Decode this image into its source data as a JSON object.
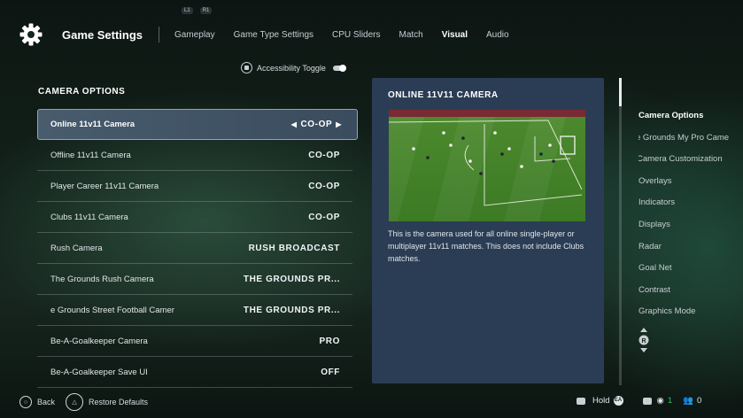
{
  "top_chips": [
    "L1",
    "R1"
  ],
  "header": {
    "title": "Game Settings",
    "tabs": [
      "Gameplay",
      "Game Type Settings",
      "CPU Sliders",
      "Match",
      "Visual",
      "Audio"
    ],
    "active_tab": "Visual"
  },
  "accessibility": {
    "label": "Accessibility Toggle",
    "on": true
  },
  "section_title": "CAMERA OPTIONS",
  "rows": [
    {
      "label": "Online 11v11 Camera",
      "value": "CO-OP",
      "selected": true
    },
    {
      "label": "Offline 11v11 Camera",
      "value": "CO-OP"
    },
    {
      "label": "Player Career 11v11 Camera",
      "value": "CO-OP"
    },
    {
      "label": "Clubs 11v11 Camera",
      "value": "CO-OP"
    },
    {
      "label": "Rush Camera",
      "value": "RUSH BROADCAST"
    },
    {
      "label": "The Grounds Rush Camera",
      "value": "THE GROUNDS PR..."
    },
    {
      "label": "e Grounds Street Football Camer",
      "value": "THE GROUNDS PR..."
    },
    {
      "label": "Be-A-Goalkeeper Camera",
      "value": "PRO"
    },
    {
      "label": "Be-A-Goalkeeper Save UI",
      "value": "OFF"
    }
  ],
  "arrows": {
    "left": "◀",
    "right": "▶"
  },
  "panel": {
    "title": "ONLINE 11V11 CAMERA",
    "description": "This is the camera used for all online single-player or multiplayer 11v11 matches. This does not include Clubs matches."
  },
  "right_menu": [
    "Camera Options",
    "e Grounds My Pro Came",
    "Camera Customization",
    "Overlays",
    "Indicators",
    "Displays",
    "Radar",
    "Goal Net",
    "Contrast",
    "Graphics Mode"
  ],
  "right_menu_active": "Camera Options",
  "scroll_glyph": "R",
  "footer": {
    "back": "Back",
    "restore": "Restore Defaults",
    "hold": "Hold",
    "count_a": "1",
    "count_b": "0"
  },
  "colors": {
    "panel": "#2b3d54",
    "selected_row": "#485c6e",
    "accent_green": "#22c55e"
  }
}
